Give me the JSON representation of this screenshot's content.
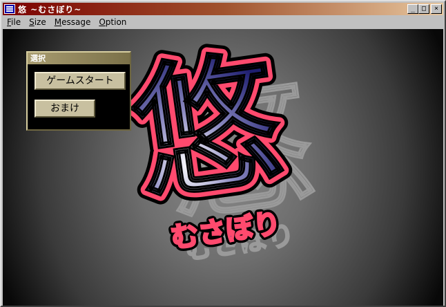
{
  "window": {
    "title": "悠 ~むさぼり~",
    "minimize": "_",
    "maximize": "□",
    "close": "×"
  },
  "menu": {
    "items": [
      {
        "first": "F",
        "rest": "ile"
      },
      {
        "first": "S",
        "rest": "ize"
      },
      {
        "first": "M",
        "rest": "essage"
      },
      {
        "first": "O",
        "rest": "ption"
      }
    ]
  },
  "panel": {
    "title": "選択",
    "start_button": "ゲームスタート",
    "omake_button": "おまけ"
  },
  "logo": {
    "kanji": "悠",
    "subtitle": "むさぼり"
  },
  "colors": {
    "logo_outline": "#ff4a6e",
    "logo_fill_dark": "#2a2a80",
    "logo_fill_light": "#ffffff"
  }
}
